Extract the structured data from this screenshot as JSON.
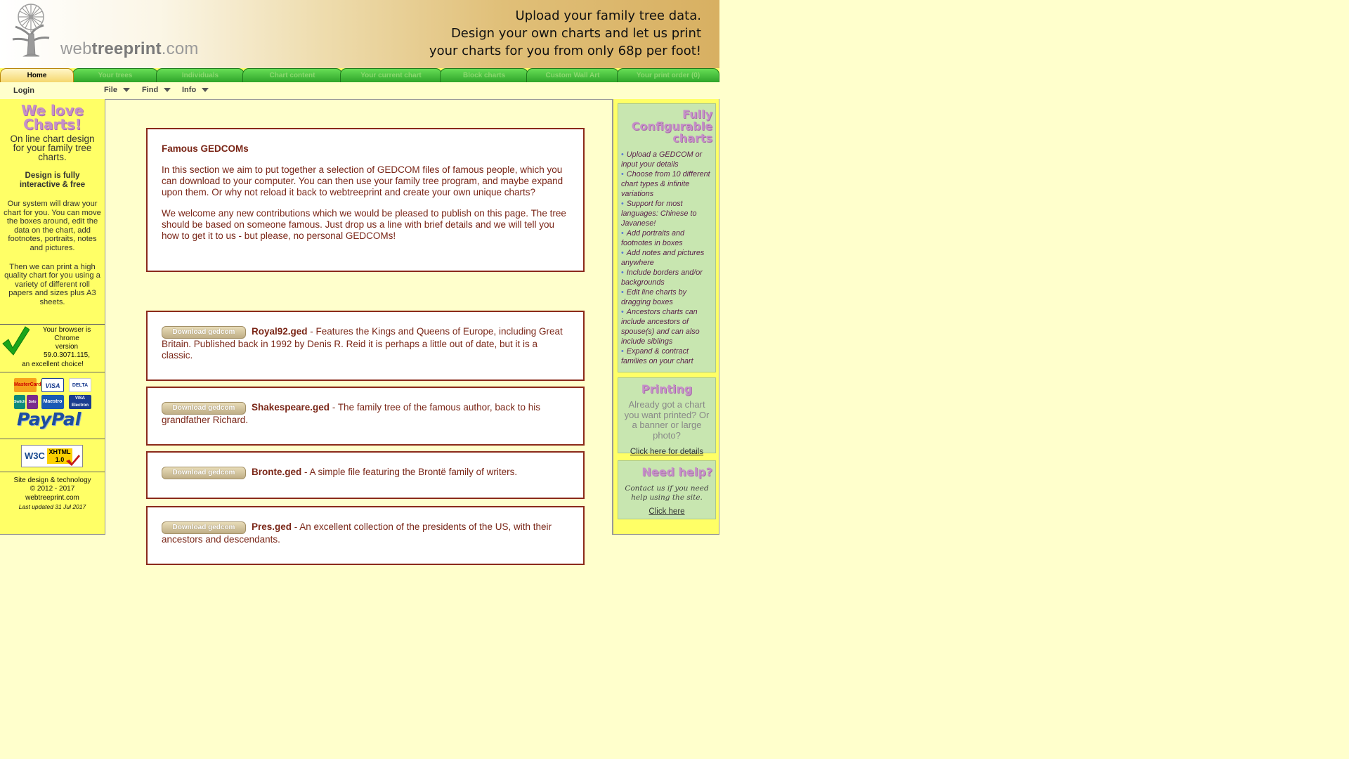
{
  "header": {
    "logo_web": "web",
    "logo_tree": "treeprint",
    "logo_com": ".com",
    "tagline": [
      "Upload your family tree data.",
      "Design your own charts and let us print",
      "your charts for you from only 68p per foot!"
    ]
  },
  "nav": {
    "tabs": [
      {
        "label": "Home",
        "active": true
      },
      {
        "label": "Your trees"
      },
      {
        "label": "Individuals"
      },
      {
        "label": "Chart content"
      },
      {
        "label": "Your current chart"
      },
      {
        "label": "Block charts"
      },
      {
        "label": "Custom Wall Art"
      },
      {
        "label": "Your print order (0)"
      }
    ]
  },
  "menubar": {
    "login": "Login",
    "menus": [
      "File",
      "Find",
      "Info"
    ]
  },
  "left": {
    "love_line1": "We love",
    "love_line2": "Charts!",
    "love_sub": "On line chart design for your family tree charts.",
    "design_free_1": "Design is fully",
    "design_free_2": "interactive & free",
    "para1": "Our system will draw your chart for you. You can move the boxes around, edit the data on the chart, add footnotes, portraits, notes and pictures.",
    "para2": "Then we can print a high quality chart for you using a variety of different roll papers and sizes plus A3 sheets.",
    "browser_lines": [
      "Your browser is",
      "Chrome",
      "version",
      "59.0.3071.115,",
      "an excellent choice!"
    ],
    "cards": [
      "MasterCard",
      "VISA",
      "DELTA",
      "Switch",
      "Solo",
      "Maestro",
      "VISA Electron"
    ],
    "paypal": "PayPal",
    "w3c_label": "W3C",
    "xhtml_label": "XHTML 1.0",
    "credits": [
      "Site design & technology",
      "© 2012 - 2017",
      "webtreeprint.com"
    ],
    "updated": "Last updated 31 Jul 2017"
  },
  "main": {
    "intro_title": "Famous GEDCOMs",
    "intro_p1": "In this section we aim to put together a selection of GEDCOM files of famous people, which you can download to your computer. You can then use your family tree program, and maybe expand upon them. Or why not reload it back to webtreeprint and create your own unique charts?",
    "intro_p2": "We welcome any new contributions which we would be pleased to publish on this page. The tree should be based on someone famous. Just drop us a line with brief details and we will tell you how to get it to us - but please, no personal GEDCOMs!",
    "download_label": "Download gedcom",
    "gedcoms": [
      {
        "name": "Royal92.ged",
        "desc": " - Features the Kings and Queens of Europe, including Great Britain. Published back in 1992 by Denis R. Reid it is perhaps a little out of date, but it is a classic."
      },
      {
        "name": "Shakespeare.ged",
        "desc": " - The family tree of the famous author, back to his grandfather Richard."
      },
      {
        "name": "Bronte.ged",
        "desc": " - A simple file featuring the Brontë family of writers."
      },
      {
        "name": "Pres.ged",
        "desc": " - An excellent collection of the presidents of the US, with their ancestors and descendants."
      }
    ]
  },
  "right": {
    "features_title": [
      "Fully",
      "Configurable",
      "charts"
    ],
    "features": [
      "Upload a GEDCOM or input your details",
      "Choose from 10 different chart types & infinite variations",
      "Support for most languages: Chinese to Javanese!",
      "Add portraits and footnotes in boxes",
      "Add notes and pictures anywhere",
      "Include borders and/or backgrounds",
      "Edit line charts by dragging boxes",
      "Ancestors charts can include ancestors of spouse(s) and can also include siblings",
      "Expand & contract families on your chart"
    ],
    "printing_title": "Printing",
    "printing_text": "Already got a chart you want printed? Or a banner or large photo?",
    "printing_link": "Click here for details",
    "help_title": "Need help?",
    "help_text": "Contact us if you need help using the site.",
    "help_link": "Click here"
  },
  "colors": {
    "page_bg": "#ffffcc",
    "sidebar_bg": "#ffff66",
    "panel_green": "#c8e6b0",
    "box_border": "#8b2a1a",
    "text_brown": "#7a2617",
    "tab_green": "#3cbc34",
    "heading_purple": "#c590c8"
  }
}
